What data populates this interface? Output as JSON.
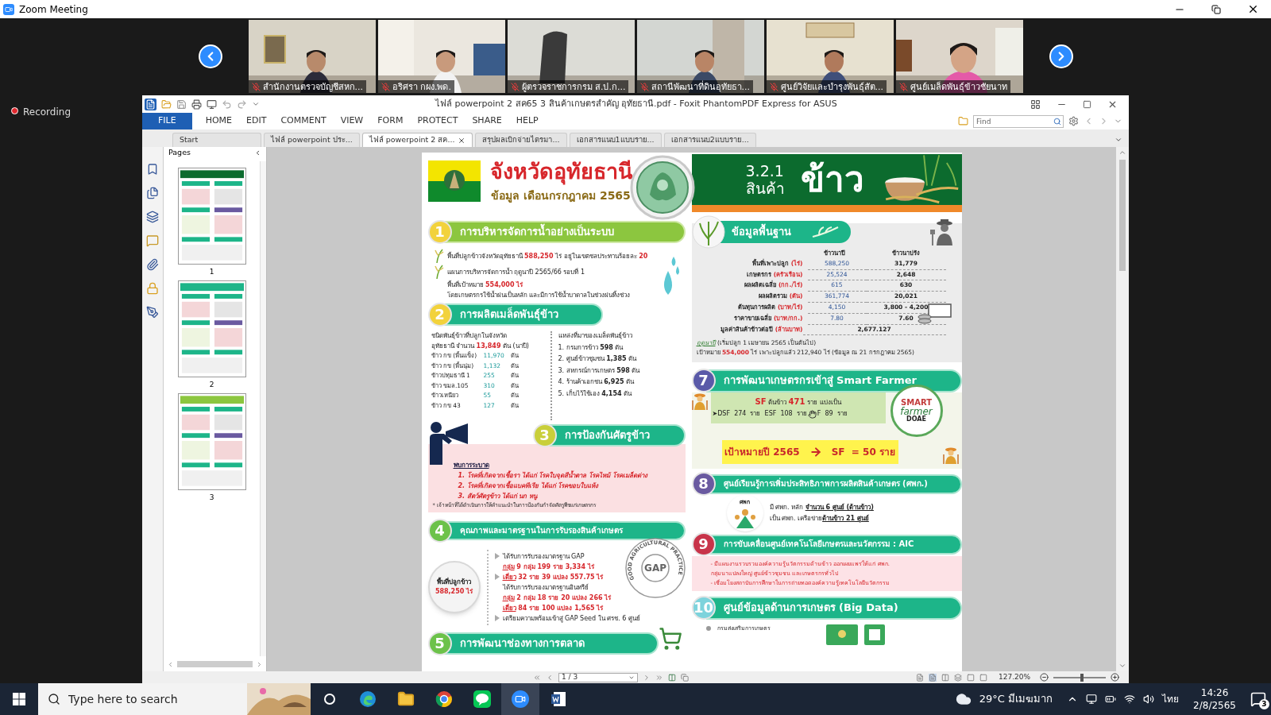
{
  "window": {
    "title": "Zoom Meeting"
  },
  "participants": [
    {
      "name": "สำนักงานตรวจบัญชีสหก...",
      "muted": true
    },
    {
      "name": "อริศรา กผง.พด.",
      "muted": true
    },
    {
      "name": "ผู้ตรวจราชการกรม ส.ป.ก...",
      "muted": true
    },
    {
      "name": "สถานีพัฒนาที่ดินอุทัยธา...",
      "muted": true
    },
    {
      "name": "ศูนย์วิจัยและบำรุงพันธุ์สัต...",
      "muted": true
    },
    {
      "name": "ศูนย์เมล็ดพันธุ์ข้าวชัยนาท",
      "muted": true
    }
  ],
  "recording": "Recording",
  "pdf_app": {
    "title": "ไฟล์ powerpoint 2 สค65 3 สินค้าเกษตรสำคัญ อุทัยธานี.pdf - Foxit PhantomPDF Express for ASUS",
    "menu": [
      {
        "label": "FILE",
        "selected": true
      },
      {
        "label": "HOME",
        "selected": false
      },
      {
        "label": "EDIT",
        "selected": false
      },
      {
        "label": "COMMENT",
        "selected": false
      },
      {
        "label": "VIEW",
        "selected": false
      },
      {
        "label": "FORM",
        "selected": false
      },
      {
        "label": "PROTECT",
        "selected": false
      },
      {
        "label": "SHARE",
        "selected": false
      },
      {
        "label": "HELP",
        "selected": false
      }
    ],
    "find_placeholder": "Find",
    "tabs": [
      {
        "label": "Start",
        "selected": false
      },
      {
        "label": "ไฟล์ powerpoint ประ...",
        "selected": false
      },
      {
        "label": "ไฟล์ powerpoint 2 สค...",
        "selected": true
      },
      {
        "label": "สรุปผลเบิกจ่ายไตรมา...",
        "selected": false
      },
      {
        "label": "เอกสารแนบ1แบบราย...",
        "selected": false
      },
      {
        "label": "เอกสารแนบ2แบบราย...",
        "selected": false
      }
    ],
    "pages_panel": {
      "title": "Pages",
      "thumbnails": [
        "1",
        "2",
        "3"
      ]
    },
    "document": {
      "province": "จังหวัดอุทัยธานี",
      "subtitle": "ข้อมูล เดือนกรกฎาคม 2565",
      "code": "3.2.1",
      "product_label": "สินค้า",
      "product": "ข้าว",
      "water": {
        "number": "1",
        "title": "การบริหารจัดการน้ำอย่างเป็นระบบ",
        "color": "#f2d23c",
        "kind": "lime",
        "lines": [
          {
            "text": "พื้นที่ปลูกข้าวจังหวัดอุทัยธานี **588,250** ไร่ อยู่ในเขตชลประทานร้อยละ **20**",
            "kind": "bullet"
          },
          {
            "text": "แผนการบริหารจัดการน้ำ ฤดูนาปี 2565/66 รอบที่ 1",
            "kind": "bullet"
          },
          {
            "text": "พื้นที่เป้าหมาย **554,000 ไร่**",
            "kind": "line"
          },
          {
            "text": "โดยเกษตรกรใช้น้ำฝนเป็นหลัก และมีการใช้น้ำบาดาลในช่วงฝนทิ้งช่วง",
            "kind": "line"
          }
        ]
      },
      "seed": {
        "number": "2",
        "title": "การผลิตเมล็ดพันธุ์ข้าว",
        "color": "#f2d23c",
        "kind": "teal",
        "intro": [
          "ชนิดพันธุ์ข้าวที่ปลูกในจังหวัด",
          "อุทัยธานี จำนวน **13,849** ตัน (นาปี)"
        ],
        "varieties": [
          {
            "name": "ข้าว กข (พื้นแข็ง)",
            "amount": "11,970",
            "unit": "ตัน"
          },
          {
            "name": "ข้าว กข (พื้นนุ่ม)",
            "amount": "1,132",
            "unit": "ตัน"
          },
          {
            "name": "ข้าวปทุมธานี 1",
            "amount": "255",
            "unit": "ตัน"
          },
          {
            "name": "ข้าว ขมล.105",
            "amount": "310",
            "unit": "ตัน"
          },
          {
            "name": "ข้าวเหนียว",
            "amount": "55",
            "unit": "ตัน"
          },
          {
            "name": "ข้าว กข 43",
            "amount": "127",
            "unit": "ตัน"
          }
        ],
        "sources_title": "แหล่งที่มาของเมล็ดพันธุ์ข้าว",
        "sources": [
          "1. กรมการข้าว **598** ตัน",
          "2. ศูนย์ข้าวชุมชน **1,385** ตัน",
          "3. สหกรณ์การเกษตร  **598** ตัน",
          "4. ร้านค้าเอกชน  **6,925** ตัน",
          "5. เก็บไว้ใช้เอง  **4,154** ตัน"
        ]
      },
      "pests": {
        "number": "3",
        "title": "การป้องกันศัตรูข้าว",
        "color": "#c9cf3a",
        "kind": "teal",
        "heading": "พบการระบาด",
        "items": [
          "1. โรคที่เกิดจากเชื้อรา ได้แก่ โรคใบจุดสีน้ำตาล โรคไหม้ โรคเมล็ดด่าง",
          "2. โรคที่เกิดจากเชื้อแบคทีเรีย ได้แก่ โรคขอบใบแห้ง",
          "3. สัตว์ศัตรูข้าว ได้แก่ นก หนู"
        ],
        "note": "* เจ้าหน้าที่ได้ดำเนินการให้คำแนะนำในการป้องกันกำจัดศัตรูพืชแก่เกษตรกร"
      },
      "quality": {
        "number": "4",
        "title": "คุณภาพและมาตรฐานในการรับรองสินค้าเกษตร",
        "color": "#6cc24a",
        "kind": "teal",
        "area_label": "พื้นที่ปลูกข้าว",
        "area_value": "588,250 ไร่",
        "stamp": "GAP",
        "stamp_ring": "GOOD AGRICULTURAL PRACTICE",
        "lines": [
          {
            "text": "ได้รับการรับรองมาตรฐาน GAP",
            "kind": "heading",
            "arrow": true
          },
          {
            "text": "**กลุ่ม** 9 กลุ่ม 199 ราย 3,334 ไร่",
            "kind": "detail",
            "arrow": false
          },
          {
            "text": "**เดี่ยว** 32 ราย 39 แปลง 557.75 ไร่",
            "kind": "detail",
            "arrow": true
          },
          {
            "text": "ได้รับการรับรองมาตรฐานอินทรีย์",
            "kind": "heading",
            "arrow": false
          },
          {
            "text": "**กลุ่ม** 2 กลุ่ม 18 ราย 20 แปลง 266 ไร่",
            "kind": "detail",
            "arrow": false
          },
          {
            "text": "**เดี่ยว** 84 ราย 100 แปลง 1,565 ไร่",
            "kind": "detail",
            "arrow": false
          },
          {
            "text": "เตรียมความพร้อมเข้าสู่ GAP Seed ใน ศรช. 6 ศูนย์",
            "kind": "heading",
            "arrow": true
          }
        ]
      },
      "market": {
        "number": "5",
        "title": "การพัฒนาช่องทางการตลาด",
        "color": "#6cc24a",
        "kind": "teal"
      },
      "basics": {
        "title": "ข้อมูลพื้นฐาน",
        "columns": [
          "ข้าวนาปี",
          "ข้าวนาปรัง"
        ],
        "rows": [
          {
            "label": "พื้นที่เพาะปลูก",
            "unit": "(ไร่)",
            "kind": "split",
            "values": [
              "588,250",
              "31,779"
            ]
          },
          {
            "label": "เกษตรกร",
            "unit": "(ครัวเรือน)",
            "kind": "split",
            "values": [
              "25,524",
              "2,648"
            ]
          },
          {
            "label": "ผลผลิตเฉลี่ย",
            "unit": "(กก./ไร่)",
            "kind": "split",
            "values": [
              "615",
              "630"
            ]
          },
          {
            "label": "ผลผลิตรวม",
            "unit": "(ตัน)",
            "kind": "split",
            "values": [
              "361,774",
              "20,021"
            ]
          },
          {
            "label": "ต้นทุนการผลิต",
            "unit": "(บาท/ไร่)",
            "kind": "split",
            "values": [
              "4,150",
              "3,800 - 4,200"
            ]
          },
          {
            "label": "ราคาขายเฉลี่ย",
            "unit": "(บาท/กก.)",
            "kind": "split",
            "values": [
              "7.80",
              "7.60"
            ]
          },
          {
            "label": "มูลค่าสินค้าข้าวต่อปี",
            "unit": "(ล้านบาท)",
            "kind": "merged",
            "values": [
              "2,677.127"
            ]
          }
        ],
        "notes": [
          "*ฤดูนาปี* (เริ่มปลูก 1 เมษายน 2565 เป็นต้นไป)",
          "เป้าหมาย **554,000** ไร่ เพาะปลูกแล้ว 212,940 ไร่ (ข้อมูล ณ 21 กรกฎาคม 2565)"
        ]
      },
      "smart_farmer": {
        "number": "7",
        "title": "การพัฒนาเกษตรกรเข้าสู่ Smart Farmer",
        "color": "#5a5aa8",
        "kind": "teal",
        "summary": "**SF** ต้นข้าว **471** ราย แบ่งเป็น",
        "breakdown": "➤DSF  274  ราย  ESF  108  ราย",
        "breakdown_tail": "F  89  ราย",
        "logo": [
          "SMART",
          "farmer",
          "DOAE"
        ],
        "target_label": "เป้าหมายปี 2565",
        "target_value": "SF  = 50 ราย"
      },
      "learning_center": {
        "number": "8",
        "title": "ศูนย์เรียนรู้การเพิ่มประสิทธิภาพการผลิตสินค้าเกษตร (ศพก.)",
        "color": "#6a5aa0",
        "kind": "teal",
        "logo": "ศพก",
        "lines": [
          "มี ศพก. หลัก **จำนวน 6 ศูนย์  (ด้านข้าว)**",
          "เป็น ศพก. เครือข่าย**ด้านข้าว 21 ศูนย์**"
        ]
      },
      "aic": {
        "number": "9",
        "title": "การขับเคลื่อนศูนย์เทคโนโลยีเกษตรและนวัตกรรม : AIC",
        "color": "#c8344a",
        "kind": "teal",
        "lines": [
          "- มีแผนงานรวบรวมองค์ความรู้นวัตกรรมด้านข้าว ออกเผยแพร่ให้แก่ ศพก.",
          "กลุ่มนาแปลงใหญ่ ศูนย์ข้าวชุมชน และเกษตรกรทั่วไป",
          "- เชื่อมโยงสถาบันการศึกษาในการถ่ายทอดองค์ความรู้เทคโนโลยีนวัตกรรม"
        ]
      },
      "big_data": {
        "number": "10",
        "title": "ศูนย์ข้อมูลด้านการเกษตร (Big Data)",
        "color": "#7dd3dc",
        "kind": "teal",
        "line": "กรมส่งเสริมการเกษตร"
      }
    },
    "status": {
      "page": "1 / 3",
      "zoom": "127.20%",
      "zoom_slider": {
        "level": 0.55
      }
    }
  },
  "taskbar": {
    "search_placeholder": "Type here to search",
    "weather": "29°C มีเมฆมาก",
    "language": "ไทย",
    "time": "14:26",
    "date": "2/8/2565",
    "notifications": "3"
  }
}
